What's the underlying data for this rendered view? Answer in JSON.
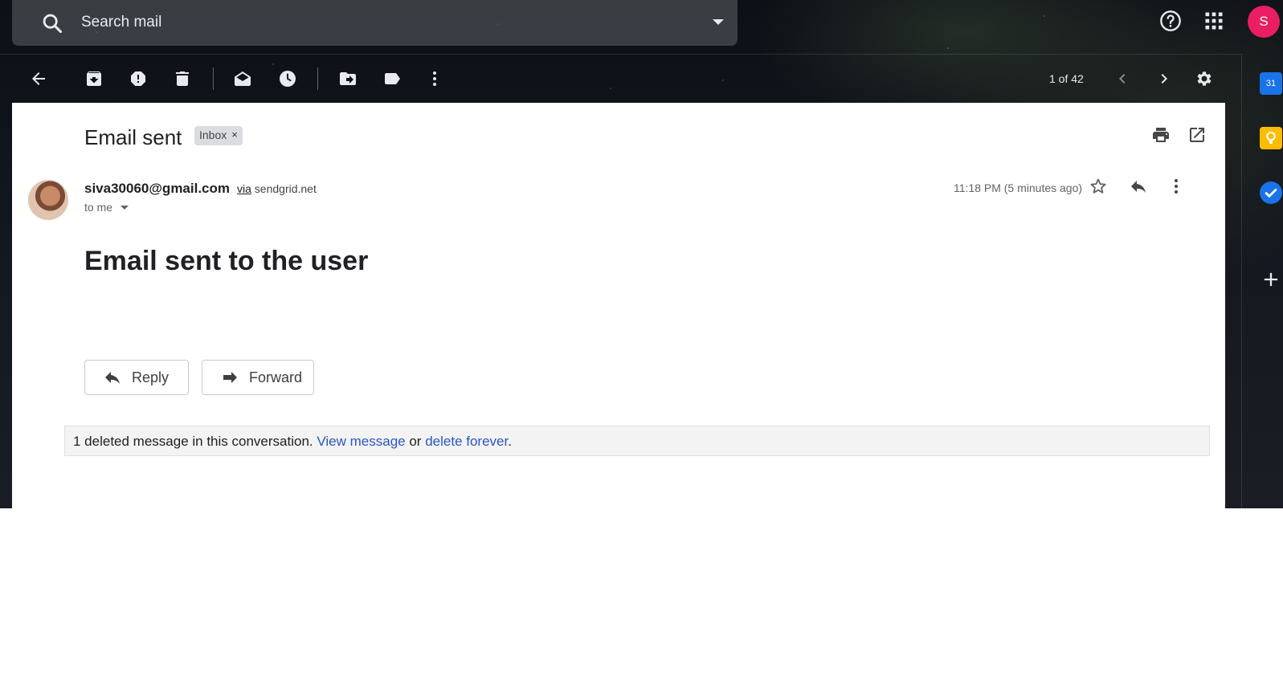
{
  "search": {
    "placeholder": "Search mail"
  },
  "header": {
    "avatar_letter": "S",
    "avatar_color": "#e91e63"
  },
  "toolbar": {
    "back": "arrow-back-icon",
    "archive": "archive-icon",
    "report_spam": "report-spam-icon",
    "delete": "delete-icon",
    "mark_unread": "mark-unread-icon",
    "snooze": "snooze-icon",
    "move_to": "move-to-icon",
    "labels": "label-icon",
    "more": "more-vert-icon",
    "pager": "1 of 42",
    "settings": "gear-icon"
  },
  "message": {
    "subject": "Email sent",
    "label": "Inbox",
    "label_remove": "×",
    "sender_email": "siva30060@gmail.com",
    "via_word": "via",
    "via_domain": "sendgrid.net",
    "recipient": "to me",
    "timestamp": "11:18 PM (5 minutes ago)",
    "body_heading": "Email sent to the user"
  },
  "actions": {
    "reply": "Reply",
    "forward": "Forward"
  },
  "deleted_notice": {
    "prefix": "1 deleted message in this conversation.",
    "view_link": "View message",
    "connector": "or",
    "delete_link": "delete forever",
    "suffix": "."
  },
  "side_panel": {
    "calendar_day": "31",
    "colors": {
      "calendar": "#1a73e8",
      "keep": "#fbbc04",
      "tasks": "#1a73e8"
    }
  }
}
